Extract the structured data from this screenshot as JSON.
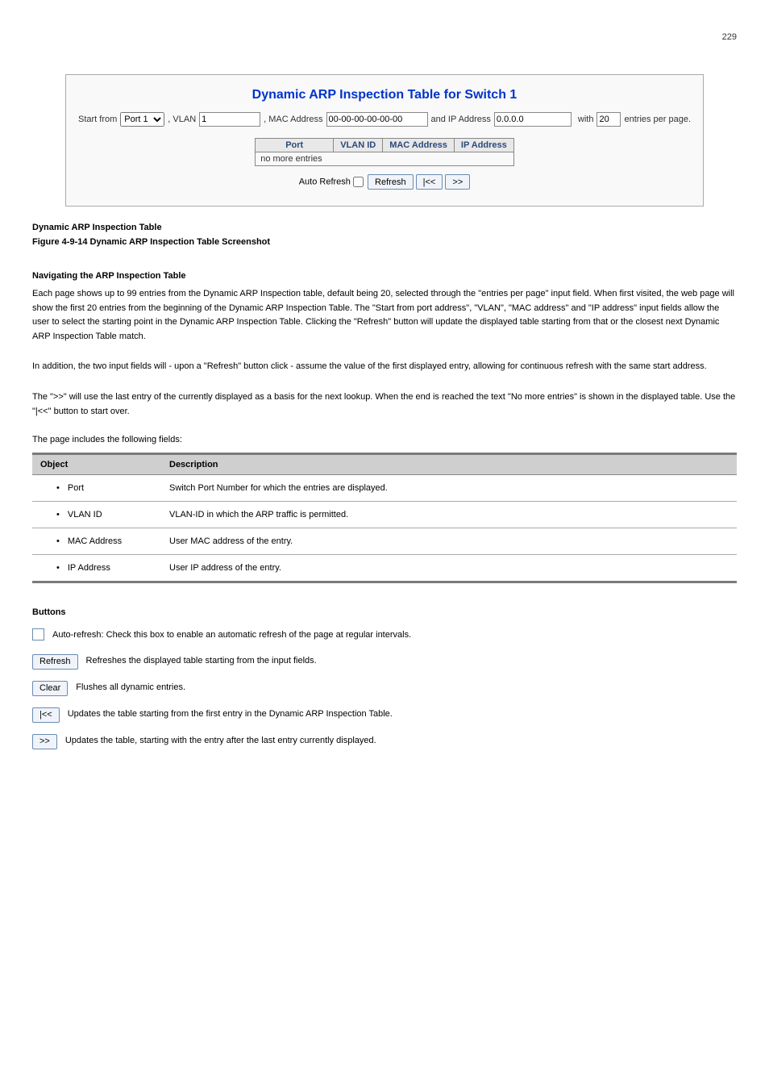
{
  "page_number_top": "229",
  "panel": {
    "title": "Dynamic ARP Inspection Table for Switch 1",
    "start_from_label": "Start from",
    "port_select_value": "Port 1",
    "vlan_label": ", VLAN",
    "vlan_value": "1",
    "mac_label": ", MAC Address",
    "mac_value": "00-00-00-00-00-00",
    "ip_label": "and IP Address",
    "ip_value": "0.0.0.0",
    "with_label": "with",
    "entries_value": "20",
    "entries_suffix": "entries per page.",
    "headers": {
      "port": "Port",
      "vlan": "VLAN ID",
      "mac": "MAC Address",
      "ip": "IP Address"
    },
    "no_more": "no more entries",
    "auto_refresh_label": "Auto Refresh",
    "refresh_btn": "Refresh",
    "first_btn": "|<<",
    "next_btn": ">>"
  },
  "section_title": "Dynamic ARP Inspection Table",
  "figure_caption": "Figure 4-9-14 Dynamic ARP Inspection Table Screenshot",
  "nav_paragraph": "Each page shows up to 99 entries from the Dynamic ARP Inspection table, default being 20, selected through the \"entries per page\" input field. When first visited, the web page will show the first 20 entries from the beginning of the Dynamic ARP Inspection Table. The \"Start from port address\", \"VLAN\", \"MAC address\" and \"IP address\" input fields allow the user to select the starting point in the Dynamic ARP Inspection Table. Clicking the \"Refresh\" button will update the displayed table starting from that or the closest next Dynamic ARP Inspection Table match.",
  "nav_paragraph_2": "In addition, the two input fields will - upon a \"Refresh\" button click - assume the value of the first displayed entry, allowing for continuous refresh with the same start address.",
  "nav_paragraph_3": "The \">>\" will use the last entry of the currently displayed as a basis for the next lookup. When the end is reached the text \"No more entries\" is shown in the displayed table. Use the \"|<<\" button to start over.",
  "obj_table": {
    "h_object": "Object",
    "h_desc": "Description",
    "rows": [
      {
        "obj": "Port",
        "desc": "Switch Port Number for which the entries are displayed."
      },
      {
        "obj": "VLAN ID",
        "desc": "VLAN-ID in which the ARP traffic is permitted."
      },
      {
        "obj": "MAC Address",
        "desc": "User MAC address of the entry."
      },
      {
        "obj": "IP Address",
        "desc": "User IP address of the entry."
      }
    ]
  },
  "buttons_heading": "Buttons",
  "button_rows": [
    {
      "icon": "checkbox",
      "text_parts": [
        "Auto-refresh: Check this box to enable an automatic refresh of the page at regular intervals."
      ]
    },
    {
      "icon": "refresh",
      "text_parts": [
        "Refreshes the displayed table starting from the input fields."
      ]
    },
    {
      "icon": "clear",
      "text_parts": [
        "Flushes all dynamic entries."
      ]
    },
    {
      "icon": "first",
      "text_parts": [
        "Updates the table starting from the first entry in the Dynamic ARP Inspection Table."
      ]
    },
    {
      "icon": "next",
      "text_parts": [
        "Updates the table, starting with the entry after the last entry currently displayed."
      ]
    }
  ],
  "icon_labels": {
    "refresh": "Refresh",
    "clear": "Clear",
    "first": "|<<",
    "next": ">>"
  }
}
